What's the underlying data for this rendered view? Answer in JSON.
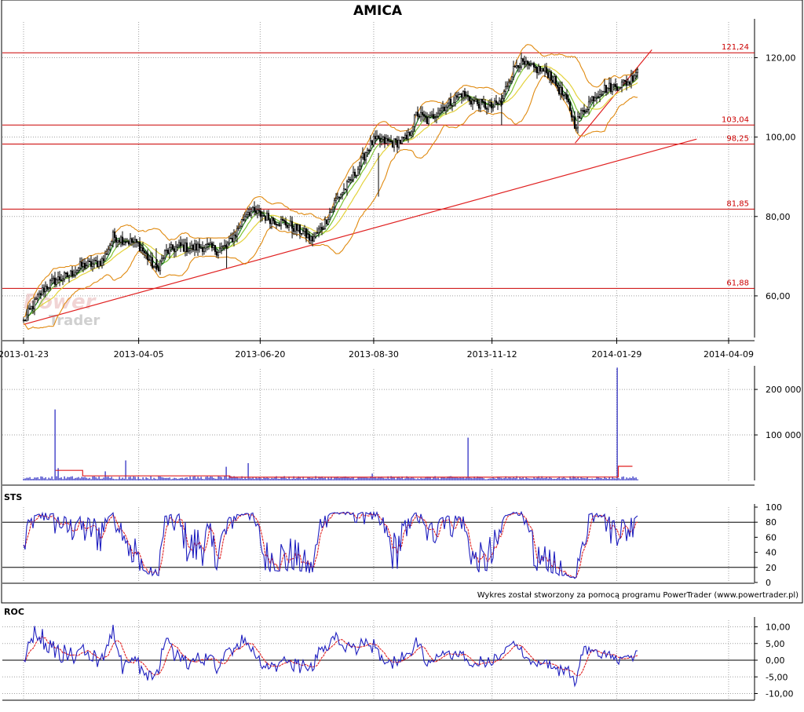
{
  "colors": {
    "candle": "#000000",
    "bollinger": "#e08a10",
    "ma_fast": "#1a7a1a",
    "ma_mid": "#7fc433",
    "ma_slow": "#e3d23c",
    "level": "#cc0000",
    "trendline": "#e02020",
    "volume": "#1f1fbf",
    "volume_avg": "#e02020",
    "sts_k": "#1f1fbf",
    "sts_d": "#e02020",
    "roc": "#1f1fbf",
    "roc_signal": "#e02020",
    "grid": "#a0a0a0"
  },
  "chart_data": [
    {
      "type": "candlestick",
      "title": "AMICA",
      "x_dates": [
        "2013-01-23",
        "2013-04-05",
        "2013-06-20",
        "2013-08-30",
        "2013-11-12",
        "2014-01-29",
        "2014-04-09"
      ],
      "y_ticks": [
        60,
        80,
        100,
        120
      ],
      "y_tick_labels": [
        "60,00",
        "80,00",
        "100,00",
        "120,00"
      ],
      "ylim": [
        49.5,
        129
      ],
      "price_path": [
        [
          "2013-01-23",
          53.5
        ],
        [
          "2013-01-28",
          57
        ],
        [
          "2013-02-05",
          62
        ],
        [
          "2013-02-12",
          64
        ],
        [
          "2013-02-20",
          65
        ],
        [
          "2013-02-28",
          67.5
        ],
        [
          "2013-03-08",
          68
        ],
        [
          "2013-03-14",
          69
        ],
        [
          "2013-03-20",
          75
        ],
        [
          "2013-03-28",
          74
        ],
        [
          "2013-04-05",
          73
        ],
        [
          "2013-04-10",
          70
        ],
        [
          "2013-04-16",
          66.5
        ],
        [
          "2013-04-22",
          71
        ],
        [
          "2013-04-30",
          72.5
        ],
        [
          "2013-05-08",
          72
        ],
        [
          "2013-05-16",
          72.5
        ],
        [
          "2013-05-24",
          71.5
        ],
        [
          "2013-05-30",
          72.5
        ],
        [
          "2013-06-05",
          76
        ],
        [
          "2013-06-12",
          81.5
        ],
        [
          "2013-06-20",
          80.5
        ],
        [
          "2013-06-26",
          79.5
        ],
        [
          "2013-07-04",
          78.5
        ],
        [
          "2013-07-10",
          77.5
        ],
        [
          "2013-07-17",
          76
        ],
        [
          "2013-07-22",
          74
        ],
        [
          "2013-07-30",
          78
        ],
        [
          "2013-08-06",
          84
        ],
        [
          "2013-08-14",
          88
        ],
        [
          "2013-08-20",
          92
        ],
        [
          "2013-08-26",
          97
        ],
        [
          "2013-08-30",
          99
        ],
        [
          "2013-09-05",
          99
        ],
        [
          "2013-09-12",
          98.5
        ],
        [
          "2013-09-20",
          99.5
        ],
        [
          "2013-09-26",
          106
        ],
        [
          "2013-10-03",
          104
        ],
        [
          "2013-10-10",
          107
        ],
        [
          "2013-10-18",
          109
        ],
        [
          "2013-10-24",
          111
        ],
        [
          "2013-10-31",
          109
        ],
        [
          "2013-11-07",
          108
        ],
        [
          "2013-11-12",
          107.5
        ],
        [
          "2013-11-18",
          109
        ],
        [
          "2013-11-22",
          114
        ],
        [
          "2013-11-28",
          119
        ],
        [
          "2013-12-05",
          117.5
        ],
        [
          "2013-12-12",
          117
        ],
        [
          "2013-12-18",
          116
        ],
        [
          "2013-12-30",
          108
        ],
        [
          "2014-01-03",
          103
        ],
        [
          "2014-01-07",
          106
        ],
        [
          "2014-01-14",
          110
        ],
        [
          "2014-01-20",
          112
        ],
        [
          "2014-01-29",
          113
        ],
        [
          "2014-02-06",
          114
        ],
        [
          "2014-02-12",
          118
        ]
      ],
      "support_levels": [
        121.24,
        103.04,
        98.25,
        81.85,
        61.88
      ],
      "support_level_labels": [
        "121,24",
        "103,04",
        "98,25",
        "81,85",
        "61,88"
      ],
      "trendlines": [
        [
          [
            "2013-01-23",
            52.8
          ],
          [
            "2014-03-20",
            99.5
          ]
        ],
        [
          [
            "2014-01-03",
            98.5
          ],
          [
            "2014-02-20",
            122
          ]
        ]
      ],
      "watermark": [
        "Power",
        "Trader"
      ],
      "grid": true
    },
    {
      "type": "bar",
      "name": "volume",
      "y_ticks": [
        100000,
        200000
      ],
      "y_tick_labels": [
        "100 000",
        "200 000"
      ],
      "ylim": [
        0,
        245000
      ],
      "spikes": [
        [
          "2013-02-12",
          156000
        ],
        [
          "2013-02-14",
          27000
        ],
        [
          "2013-03-15",
          20000
        ],
        [
          "2013-03-28",
          44000
        ],
        [
          "2013-05-30",
          30000
        ],
        [
          "2013-06-13",
          38000
        ],
        [
          "2013-08-29",
          15000
        ],
        [
          "2013-10-28",
          94000
        ],
        [
          "2014-01-30",
          248000
        ]
      ],
      "average_levels": [
        [
          "2013-02-12",
          22000
        ],
        [
          "2013-03-01",
          10000
        ],
        [
          "2013-06-01",
          7000
        ],
        [
          "2013-11-15",
          7500
        ],
        [
          "2014-01-30",
          31000
        ]
      ],
      "grid": true
    },
    {
      "type": "line",
      "name": "STS",
      "title": "STS",
      "y_ticks": [
        0,
        20,
        40,
        60,
        80,
        100
      ],
      "y_tick_labels": [
        "0",
        "20",
        "40",
        "60",
        "80",
        "100"
      ],
      "reference_lines": [
        20,
        80
      ],
      "ylim": [
        0,
        100
      ],
      "grid": true
    },
    {
      "type": "line",
      "name": "ROC",
      "title": "ROC",
      "y_ticks": [
        -10,
        -5,
        0,
        5,
        10
      ],
      "y_tick_labels": [
        "-10,00",
        "-5,00",
        "0,00",
        "5,00",
        "10,00"
      ],
      "reference_lines": [
        0
      ],
      "ylim": [
        -12,
        12
      ],
      "grid": true
    }
  ],
  "footer": {
    "credit": "Wykres został stworzony za pomocą programu PowerTrader (www.powertrader.pl)"
  }
}
